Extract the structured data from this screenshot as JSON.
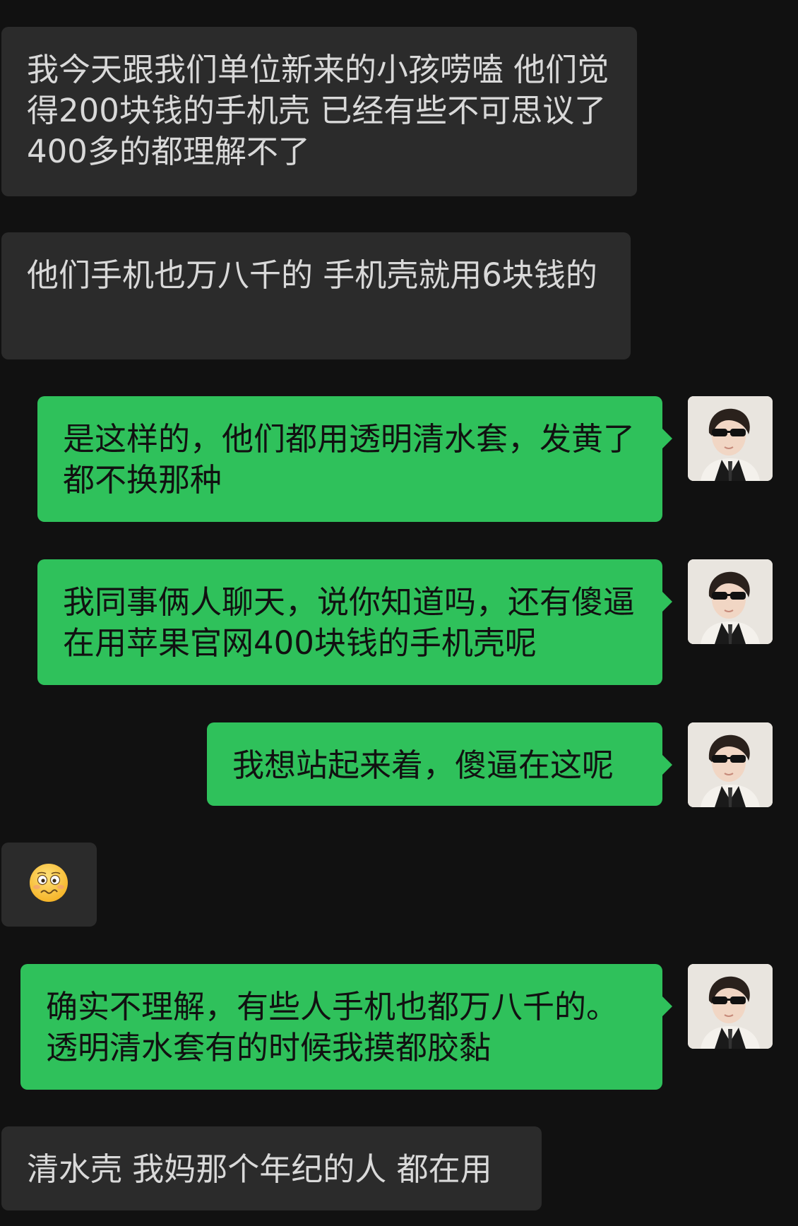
{
  "messages": [
    {
      "side": "in",
      "text": "我今天跟我们单位新来的小孩唠嗑 他们觉得200块钱的手机壳 已经有些不可思议了 400多的都理解不了"
    },
    {
      "side": "in",
      "text": "他们手机也万八千的 手机壳就用6块钱的"
    },
    {
      "side": "out",
      "text": "是这样的，他们都用透明清水套，发黄了都不换那种"
    },
    {
      "side": "out",
      "text": "我同事俩人聊天，说你知道吗，还有傻逼在用苹果官网400块钱的手机壳呢"
    },
    {
      "side": "out",
      "text": "我想站起来着，傻逼在这呢"
    },
    {
      "side": "in",
      "emoji": "woozy-face-emoji"
    },
    {
      "side": "out",
      "text": "确实不理解，有些人手机也都万八千的。透明清水套有的时候我摸都胶黏"
    },
    {
      "side": "in",
      "text": "清水壳 我妈那个年纪的人 都在用"
    }
  ],
  "colors": {
    "background": "#111111",
    "incoming_bubble": "#2b2b2b",
    "outgoing_bubble": "#2fc15b",
    "incoming_text": "#d9d9d9",
    "outgoing_text": "#111111"
  },
  "avatar_icon": "boy-sunglasses-avatar"
}
